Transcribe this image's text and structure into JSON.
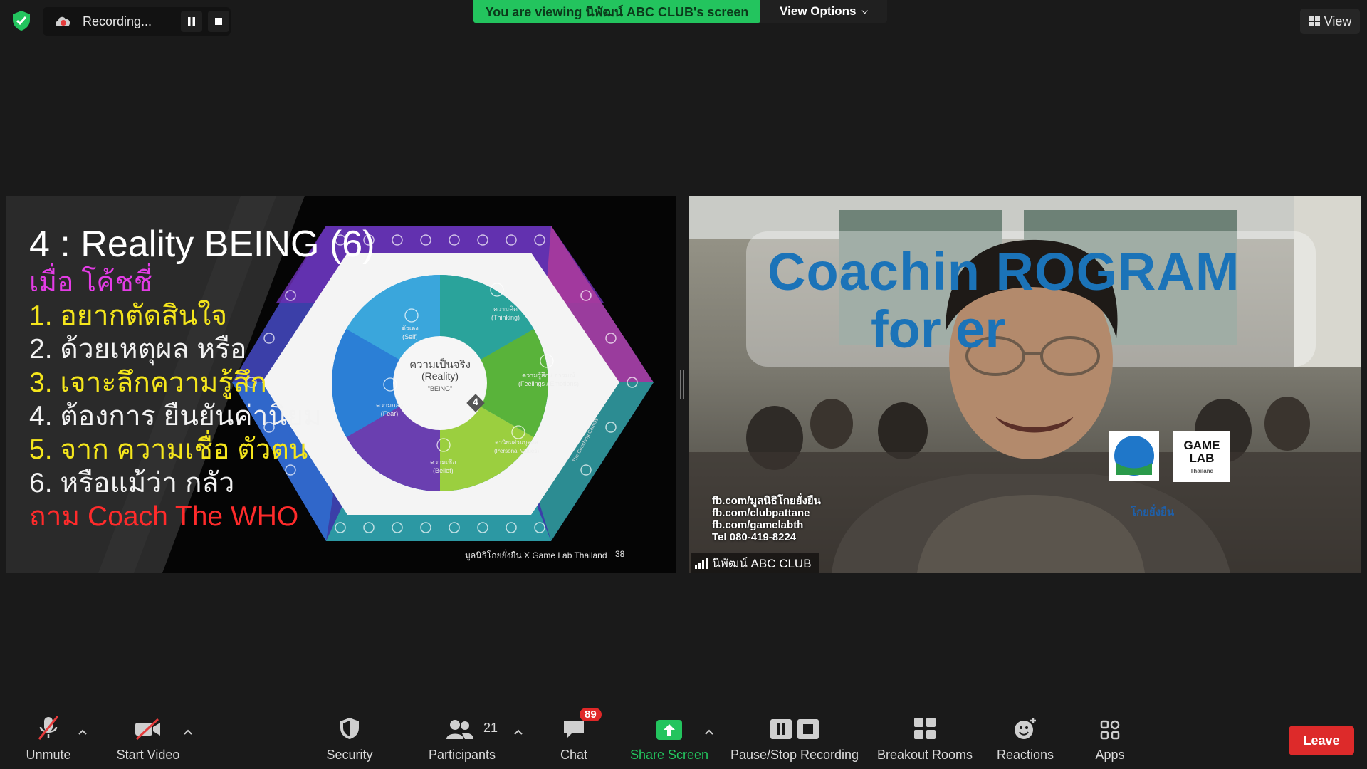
{
  "recording": {
    "text": "Recording..."
  },
  "banner": {
    "text": "You are viewing นิพัฒน์ ABC CLUB's screen"
  },
  "view_options": {
    "label": "View Options"
  },
  "view_button": {
    "label": "View"
  },
  "slide": {
    "title": "4 : Reality BEING (6)",
    "lines": [
      {
        "text": "เมื่อ โค้ชชี่",
        "color": "#e43ce6"
      },
      {
        "text": "1.  อยากตัดสินใจ",
        "color": "#f5e61c"
      },
      {
        "text": "2. ด้วยเหตุผล หรือ",
        "color": "#f2f2f2"
      },
      {
        "text": "3. เจาะลึกความรู้สึก",
        "color": "#f5e61c"
      },
      {
        "text": "4. ต้องการ ยืนยันค่านิยม",
        "color": "#f2f2f2"
      },
      {
        "text": "5. จาก ความเชื่อ ตัวตน",
        "color": "#f5e61c"
      },
      {
        "text": "6. หรือแม้ว่า กลัว",
        "color": "#f2f2f2"
      },
      {
        "text": "ถาม Coach The WHO",
        "color": "#ff2b2b"
      }
    ],
    "wheel": {
      "center_title": "ความเป็นจริง",
      "center_sub": "(Reality)",
      "center_being": "\"BEING\"",
      "center_num": "4",
      "segments": [
        {
          "th": "ความคิด",
          "en": "(Thinking)",
          "color": "#2aa39b"
        },
        {
          "th": "ความรู้สึก / อารมณ์",
          "en": "(Feelings / Emotions)",
          "color": "#6bbd3a"
        },
        {
          "th": "ค่านิยมส่วนบุคคล",
          "en": "(Personal Values)",
          "color": "#9bcf3f"
        },
        {
          "th": "ความเชื่อ",
          "en": "(Belief)",
          "color": "#6a3fb0"
        },
        {
          "th": "ความกลัว",
          "en": "(Fear)",
          "color": "#2b7fd6"
        },
        {
          "th": "ตัวเอง",
          "en": "(Self)",
          "color": "#2f9ad9"
        }
      ],
      "side_label": "The Coaching Canvas"
    },
    "footer": "มูลนิธิโกยยั่งยืน X Game Lab Thailand",
    "page_number": "38"
  },
  "video": {
    "participant_name": "นิพัฒน์ ABC CLUB",
    "backdrop_title_1": "Coachin  ROGRAM",
    "backdrop_title_2": "for       er",
    "contact": [
      "fb.com/มูลนิธิโกยยั่งยืน",
      "fb.com/clubpattane",
      "fb.com/gamelabth",
      "Tel 080-419-8224"
    ],
    "logo_text": "GAME LAB",
    "logo_sub": "Thailand",
    "partial_text": "โกยยั่งยืน"
  },
  "toolbar": {
    "unmute": "Unmute",
    "start_video": "Start Video",
    "security": "Security",
    "participants": "Participants",
    "participants_count": "21",
    "chat": "Chat",
    "chat_badge": "89",
    "share_screen": "Share Screen",
    "pause_stop_recording": "Pause/Stop Recording",
    "breakout_rooms": "Breakout Rooms",
    "reactions": "Reactions",
    "apps": "Apps",
    "leave": "Leave"
  },
  "colors": {
    "banner_green": "#23c45e",
    "leave_red": "#dd2a2a",
    "badge_red": "#e02828",
    "background": "#1a1a1a"
  }
}
